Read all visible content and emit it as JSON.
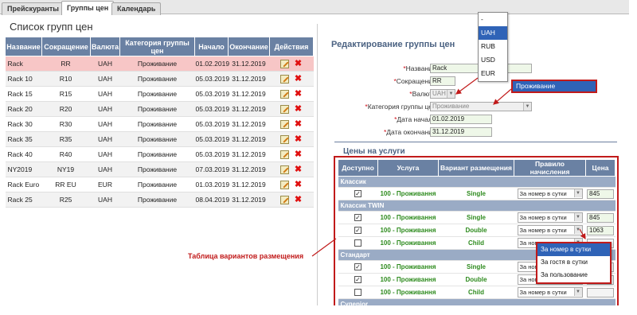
{
  "tabs": [
    "Прейскуранты",
    "Группы цен",
    "Календарь"
  ],
  "list": {
    "title": "Список групп цен",
    "columns": [
      "Название",
      "Сокращение",
      "Валюта",
      "Категория группы цен",
      "Начало",
      "Окончание",
      "Действия"
    ],
    "rows": [
      [
        "Rack",
        "RR",
        "UAH",
        "Проживание",
        "01.02.2019",
        "31.12.2019"
      ],
      [
        "Rack 10",
        "R10",
        "UAH",
        "Проживание",
        "05.03.2019",
        "31.12.2019"
      ],
      [
        "Rack 15",
        "R15",
        "UAH",
        "Проживание",
        "05.03.2019",
        "31.12.2019"
      ],
      [
        "Rack 20",
        "R20",
        "UAH",
        "Проживание",
        "05.03.2019",
        "31.12.2019"
      ],
      [
        "Rack 30",
        "R30",
        "UAH",
        "Проживание",
        "05.03.2019",
        "31.12.2019"
      ],
      [
        "Rack 35",
        "R35",
        "UAH",
        "Проживание",
        "05.03.2019",
        "31.12.2019"
      ],
      [
        "Rack 40",
        "R40",
        "UAH",
        "Проживание",
        "05.03.2019",
        "31.12.2019"
      ],
      [
        "NY2019",
        "NY19",
        "UAH",
        "Проживание",
        "07.03.2019",
        "31.12.2019"
      ],
      [
        "Rack Euro",
        "RR EU",
        "EUR",
        "Проживание",
        "01.03.2019",
        "31.12.2019"
      ],
      [
        "Rack 25",
        "R25",
        "UAH",
        "Проживание",
        "08.04.2019",
        "31.12.2019"
      ]
    ]
  },
  "edit": {
    "title": "Редактирование группы цен",
    "name_label": "Название:",
    "name_value": "Rack",
    "abbr_label": "Сокращение:",
    "abbr_value": "RR",
    "currency_label": "Валюта:",
    "currency_value": "UAH",
    "category_label": "Категория группы цен:",
    "category_value": "Проживание",
    "start_label": "Дата начала:",
    "start_value": "01.02.2019",
    "end_label": "Дата окончания:",
    "end_value": "31.12.2019"
  },
  "services": {
    "title": "Цены на услуги",
    "columns": [
      "Доступно",
      "Услуга",
      "Вариант размещения",
      "Правило начисления",
      "Цена"
    ],
    "groups": [
      {
        "name": "Классик",
        "rows": [
          {
            "checked": true,
            "service": "100 - Проживання",
            "variant": "Single",
            "rule": "За номер в сутки",
            "price": "845"
          }
        ]
      },
      {
        "name": "Классик TWIN",
        "rows": [
          {
            "checked": true,
            "service": "100 - Проживання",
            "variant": "Single",
            "rule": "За номер в сутки",
            "price": "845"
          },
          {
            "checked": true,
            "service": "100 - Проживання",
            "variant": "Double",
            "rule": "За номер в сутки",
            "price": "1063"
          },
          {
            "checked": false,
            "service": "100 - Проживання",
            "variant": "Child",
            "rule": "За номер в сутки",
            "price": ""
          }
        ]
      },
      {
        "name": "Стандарт",
        "rows": [
          {
            "checked": true,
            "service": "100 - Проживання",
            "variant": "Single",
            "rule": "За номер в сутки",
            "price": ""
          },
          {
            "checked": true,
            "service": "100 - Проживання",
            "variant": "Double",
            "rule": "За номер в сутки",
            "price": ""
          },
          {
            "checked": false,
            "service": "100 - Проживання",
            "variant": "Child",
            "rule": "За номер в сутки",
            "price": ""
          }
        ]
      },
      {
        "name": "Суперior",
        "rows": []
      }
    ]
  },
  "currency_dropdown": [
    "-",
    "UAH",
    "RUB",
    "USD",
    "EUR"
  ],
  "currency_selected": "UAH",
  "category_dropdown": [
    "Проживание"
  ],
  "rule_dropdown": [
    "За номер в сутки",
    "За гостя в сутки",
    "За пользование"
  ],
  "rule_selected": "За номер в сутки",
  "callout": "Таблица вариантов размещения",
  "colors": {
    "header": "#6a81a3",
    "accent": "#2f63b7",
    "highlight_row": "#f7c6c6",
    "annotation": "#c11a1a",
    "green_text": "#2e8b1e"
  }
}
